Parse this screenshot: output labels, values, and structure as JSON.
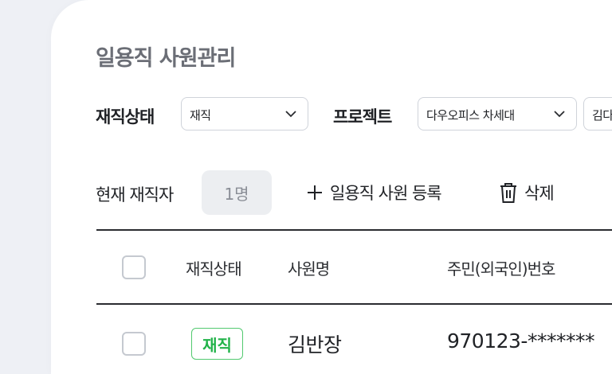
{
  "page": {
    "title": "일용직 사원관리"
  },
  "filters": {
    "employment_status_label": "재직상태",
    "employment_status_value": "재직",
    "project_label": "프로젝트",
    "project_value": "다우오피스 차세대",
    "extra_value": "김다"
  },
  "summary": {
    "current_label": "현재 재직자",
    "count": "1명"
  },
  "actions": {
    "add_label": "일용직 사원 등록",
    "delete_label": "삭제"
  },
  "table": {
    "headers": {
      "status": "재직상태",
      "name": "사원명",
      "id_number": "주민(외국인)번호"
    },
    "rows": [
      {
        "status": "재직",
        "name": "김반장",
        "id_number": "970123-*******"
      }
    ]
  },
  "colors": {
    "accent_status": "#22b34a",
    "text_primary": "#202226",
    "background": "#eef0f5"
  },
  "icons": {
    "dropdown": "chevron-down-icon",
    "add": "plus-icon",
    "delete": "trash-icon"
  }
}
